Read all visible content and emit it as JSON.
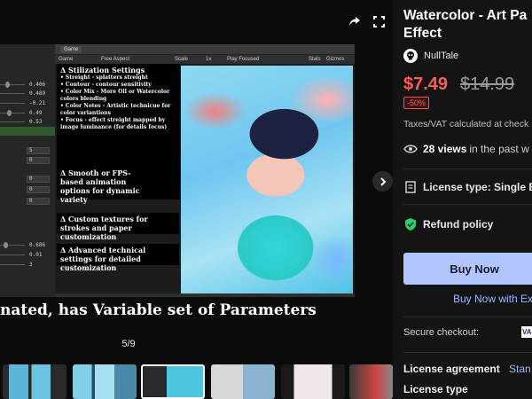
{
  "viewer": {
    "inspector_values": [
      "0.406",
      "0.489",
      "-0.21",
      "0.49",
      "0.53",
      "5",
      "0",
      "0",
      "0",
      "0",
      "0.686",
      "0.01",
      "3"
    ],
    "game_tab": "Game",
    "toolbar": {
      "display": "Game",
      "aspect": "Free Aspect",
      "scale_label": "Scale",
      "scale_value": "1x",
      "play_focus": "Play Focused",
      "stats": "Stats",
      "gizmos": "Gizmos"
    },
    "notes": {
      "stilization_title": "Δ Stilization Settings",
      "stilization_lines": [
        "• Streight - splatters streight",
        "• Contour - contour sensitivity",
        "• Color Mix - More Oil or Watercolor colors blending",
        "• Color Notes - Artistic technicue for color variantions",
        "• Focus - effect streight mapped by image luminance (for details focus)"
      ],
      "animation": "Δ Smooth or FPS-based animation options for dynamic variety",
      "textures": "Δ Custom textures for strokes and paper customization",
      "advanced": "Δ Advanced technical settings for detailed customization"
    },
    "caption": "nated, has Variable set of Parameters",
    "counter": "5/9"
  },
  "product": {
    "title_line1": "Watercolor - Art Pa",
    "title_line2": "Effect",
    "seller": "NullTale",
    "price": "$7.49",
    "old_price": "$14.99",
    "discount": "-50%",
    "tax_note": "Taxes/VAT calculated at check",
    "views_count": "28 views",
    "views_suffix": "in the past w",
    "license_type": "License type: Single E",
    "refund": "Refund policy",
    "buy_now": "Buy Now",
    "buy_now_with": "Buy Now with Ex",
    "secure_checkout": "Secure checkout:",
    "secure_badge": "VA",
    "license_agreement_label": "License agreement",
    "license_agreement_value": "Stan",
    "license_type_label": "License type"
  },
  "colors": {
    "accent_button": "#b0c4ff",
    "price_red": "#ff5a5a",
    "link_blue": "#9bb6ff",
    "refund_green": "#2ecc71"
  }
}
